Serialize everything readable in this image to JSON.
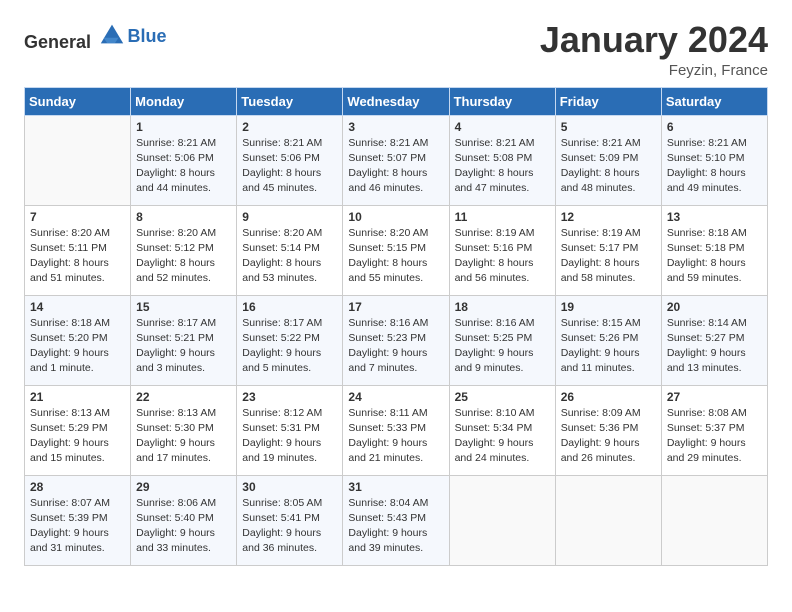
{
  "header": {
    "logo_general": "General",
    "logo_blue": "Blue",
    "month_title": "January 2024",
    "location": "Feyzin, France"
  },
  "weekdays": [
    "Sunday",
    "Monday",
    "Tuesday",
    "Wednesday",
    "Thursday",
    "Friday",
    "Saturday"
  ],
  "weeks": [
    [
      {
        "day": "",
        "sunrise": "",
        "sunset": "",
        "daylight": ""
      },
      {
        "day": "1",
        "sunrise": "Sunrise: 8:21 AM",
        "sunset": "Sunset: 5:06 PM",
        "daylight": "Daylight: 8 hours and 44 minutes."
      },
      {
        "day": "2",
        "sunrise": "Sunrise: 8:21 AM",
        "sunset": "Sunset: 5:06 PM",
        "daylight": "Daylight: 8 hours and 45 minutes."
      },
      {
        "day": "3",
        "sunrise": "Sunrise: 8:21 AM",
        "sunset": "Sunset: 5:07 PM",
        "daylight": "Daylight: 8 hours and 46 minutes."
      },
      {
        "day": "4",
        "sunrise": "Sunrise: 8:21 AM",
        "sunset": "Sunset: 5:08 PM",
        "daylight": "Daylight: 8 hours and 47 minutes."
      },
      {
        "day": "5",
        "sunrise": "Sunrise: 8:21 AM",
        "sunset": "Sunset: 5:09 PM",
        "daylight": "Daylight: 8 hours and 48 minutes."
      },
      {
        "day": "6",
        "sunrise": "Sunrise: 8:21 AM",
        "sunset": "Sunset: 5:10 PM",
        "daylight": "Daylight: 8 hours and 49 minutes."
      }
    ],
    [
      {
        "day": "7",
        "sunrise": "Sunrise: 8:20 AM",
        "sunset": "Sunset: 5:11 PM",
        "daylight": "Daylight: 8 hours and 51 minutes."
      },
      {
        "day": "8",
        "sunrise": "Sunrise: 8:20 AM",
        "sunset": "Sunset: 5:12 PM",
        "daylight": "Daylight: 8 hours and 52 minutes."
      },
      {
        "day": "9",
        "sunrise": "Sunrise: 8:20 AM",
        "sunset": "Sunset: 5:14 PM",
        "daylight": "Daylight: 8 hours and 53 minutes."
      },
      {
        "day": "10",
        "sunrise": "Sunrise: 8:20 AM",
        "sunset": "Sunset: 5:15 PM",
        "daylight": "Daylight: 8 hours and 55 minutes."
      },
      {
        "day": "11",
        "sunrise": "Sunrise: 8:19 AM",
        "sunset": "Sunset: 5:16 PM",
        "daylight": "Daylight: 8 hours and 56 minutes."
      },
      {
        "day": "12",
        "sunrise": "Sunrise: 8:19 AM",
        "sunset": "Sunset: 5:17 PM",
        "daylight": "Daylight: 8 hours and 58 minutes."
      },
      {
        "day": "13",
        "sunrise": "Sunrise: 8:18 AM",
        "sunset": "Sunset: 5:18 PM",
        "daylight": "Daylight: 8 hours and 59 minutes."
      }
    ],
    [
      {
        "day": "14",
        "sunrise": "Sunrise: 8:18 AM",
        "sunset": "Sunset: 5:20 PM",
        "daylight": "Daylight: 9 hours and 1 minute."
      },
      {
        "day": "15",
        "sunrise": "Sunrise: 8:17 AM",
        "sunset": "Sunset: 5:21 PM",
        "daylight": "Daylight: 9 hours and 3 minutes."
      },
      {
        "day": "16",
        "sunrise": "Sunrise: 8:17 AM",
        "sunset": "Sunset: 5:22 PM",
        "daylight": "Daylight: 9 hours and 5 minutes."
      },
      {
        "day": "17",
        "sunrise": "Sunrise: 8:16 AM",
        "sunset": "Sunset: 5:23 PM",
        "daylight": "Daylight: 9 hours and 7 minutes."
      },
      {
        "day": "18",
        "sunrise": "Sunrise: 8:16 AM",
        "sunset": "Sunset: 5:25 PM",
        "daylight": "Daylight: 9 hours and 9 minutes."
      },
      {
        "day": "19",
        "sunrise": "Sunrise: 8:15 AM",
        "sunset": "Sunset: 5:26 PM",
        "daylight": "Daylight: 9 hours and 11 minutes."
      },
      {
        "day": "20",
        "sunrise": "Sunrise: 8:14 AM",
        "sunset": "Sunset: 5:27 PM",
        "daylight": "Daylight: 9 hours and 13 minutes."
      }
    ],
    [
      {
        "day": "21",
        "sunrise": "Sunrise: 8:13 AM",
        "sunset": "Sunset: 5:29 PM",
        "daylight": "Daylight: 9 hours and 15 minutes."
      },
      {
        "day": "22",
        "sunrise": "Sunrise: 8:13 AM",
        "sunset": "Sunset: 5:30 PM",
        "daylight": "Daylight: 9 hours and 17 minutes."
      },
      {
        "day": "23",
        "sunrise": "Sunrise: 8:12 AM",
        "sunset": "Sunset: 5:31 PM",
        "daylight": "Daylight: 9 hours and 19 minutes."
      },
      {
        "day": "24",
        "sunrise": "Sunrise: 8:11 AM",
        "sunset": "Sunset: 5:33 PM",
        "daylight": "Daylight: 9 hours and 21 minutes."
      },
      {
        "day": "25",
        "sunrise": "Sunrise: 8:10 AM",
        "sunset": "Sunset: 5:34 PM",
        "daylight": "Daylight: 9 hours and 24 minutes."
      },
      {
        "day": "26",
        "sunrise": "Sunrise: 8:09 AM",
        "sunset": "Sunset: 5:36 PM",
        "daylight": "Daylight: 9 hours and 26 minutes."
      },
      {
        "day": "27",
        "sunrise": "Sunrise: 8:08 AM",
        "sunset": "Sunset: 5:37 PM",
        "daylight": "Daylight: 9 hours and 29 minutes."
      }
    ],
    [
      {
        "day": "28",
        "sunrise": "Sunrise: 8:07 AM",
        "sunset": "Sunset: 5:39 PM",
        "daylight": "Daylight: 9 hours and 31 minutes."
      },
      {
        "day": "29",
        "sunrise": "Sunrise: 8:06 AM",
        "sunset": "Sunset: 5:40 PM",
        "daylight": "Daylight: 9 hours and 33 minutes."
      },
      {
        "day": "30",
        "sunrise": "Sunrise: 8:05 AM",
        "sunset": "Sunset: 5:41 PM",
        "daylight": "Daylight: 9 hours and 36 minutes."
      },
      {
        "day": "31",
        "sunrise": "Sunrise: 8:04 AM",
        "sunset": "Sunset: 5:43 PM",
        "daylight": "Daylight: 9 hours and 39 minutes."
      },
      {
        "day": "",
        "sunrise": "",
        "sunset": "",
        "daylight": ""
      },
      {
        "day": "",
        "sunrise": "",
        "sunset": "",
        "daylight": ""
      },
      {
        "day": "",
        "sunrise": "",
        "sunset": "",
        "daylight": ""
      }
    ]
  ]
}
